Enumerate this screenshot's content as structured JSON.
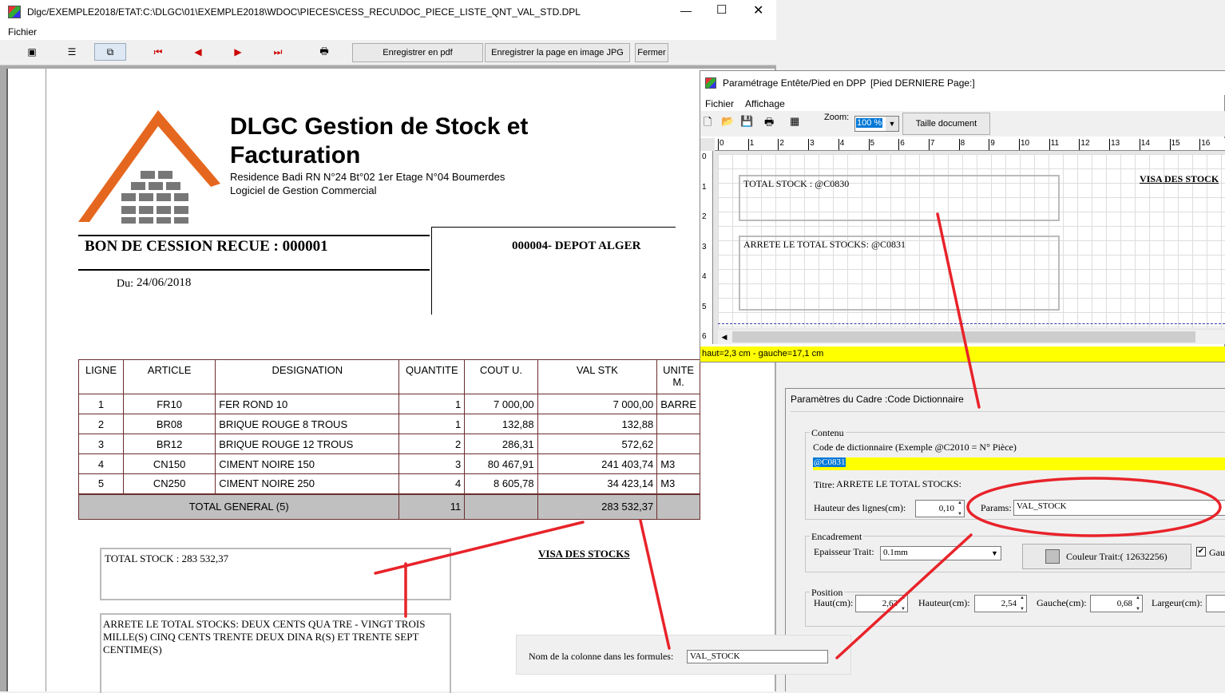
{
  "main_window": {
    "title": "Dlgc/EXEMPLE2018/ETAT:C:\\DLGC\\01\\EXEMPLE2018\\WDOC\\PIECES\\CESS_RECU\\DOC_PIECE_LISTE_QNT_VAL_STD.DPL",
    "menu": [
      "Fichier"
    ],
    "toolbar": {
      "save_pdf": "Enregistrer en pdf",
      "save_jpg": "Enregistrer la page en image JPG",
      "close": "Fermer"
    }
  },
  "document": {
    "company": "DLGC Gestion de Stock et Facturation",
    "address": "Residence Badi RN N°24 Bt°02 1er Etage N°04 Boumerdes",
    "subtitle": "Logiciel de Gestion Commercial",
    "doc_title": "BON DE CESSION RECUE : 000001",
    "depot": "000004- DEPOT ALGER",
    "date_label": "Du:",
    "date": "24/06/2018",
    "headers": [
      "LIGNE",
      "ARTICLE",
      "DESIGNATION",
      "QUANTITE",
      "COUT U.",
      "VAL STK",
      "UNITE M."
    ],
    "rows": [
      [
        "1",
        "FR10",
        "FER ROND 10",
        "1",
        "7 000,00",
        "7 000,00",
        "BARRE"
      ],
      [
        "2",
        "BR08",
        "BRIQUE ROUGE 8 TROUS",
        "1",
        "132,88",
        "132,88",
        ""
      ],
      [
        "3",
        "BR12",
        "BRIQUE ROUGE 12 TROUS",
        "2",
        "286,31",
        "572,62",
        ""
      ],
      [
        "4",
        "CN150",
        "CIMENT NOIRE 150",
        "3",
        "80 467,91",
        "241 403,74",
        "M3"
      ],
      [
        "5",
        "CN250",
        "CIMENT NOIRE 250",
        "4",
        "8 605,78",
        "34 423,14",
        "M3"
      ]
    ],
    "total_label": "TOTAL GENERAL  (5)",
    "total_qty": "11",
    "total_val": "283 532,37",
    "total_stock": "TOTAL STOCK : 283 532,37",
    "visa": "VISA  DES STOCKS",
    "arrete": "ARRETE LE TOTAL STOCKS: DEUX CENTS QUA TRE - VINGT TROIS MILLE(S) CINQ CENTS TRENTE DEUX DINA R(S) ET TRENTE SEPT CENTIME(S)"
  },
  "dpp_window": {
    "title": "Paramétrage Entête/Pied en DPP",
    "subtitle": "[Pied DERNIERE Page:]",
    "menu": [
      "Fichier",
      "Affichage"
    ],
    "zoom_label": "Zoom:",
    "zoom_value": "100 %",
    "page_size_btn": "Taille document",
    "ruler": [
      "0",
      "1",
      "2",
      "3",
      "4",
      "5",
      "6",
      "7",
      "8",
      "9",
      "10",
      "11",
      "12",
      "13",
      "14",
      "15",
      "16"
    ],
    "vruler": [
      "0",
      "1",
      "2",
      "3",
      "4",
      "5",
      "6"
    ],
    "box1": "TOTAL STOCK : @C0830",
    "box2": "ARRETE LE TOTAL STOCKS: @C0831",
    "visa": "VISA  DES STOCK",
    "status": "haut=2,3 cm - gauche=17,1 cm"
  },
  "params_window": {
    "title": "Paramètres du Cadre :Code Dictionnaire",
    "contenu_label": "Contenu",
    "code_label": "Code de dictionnaire (Exemple @C2010 = N° Pièce)",
    "code_value": "@C0831",
    "titre_label": "Titre:",
    "titre_value": "ARRETE LE TOTAL STOCKS:",
    "hauteur_lignes_label": "Hauteur des lignes(cm):",
    "hauteur_lignes_value": "0,10",
    "params_label": "Params:",
    "params_value": "VAL_STOCK",
    "encadrement_label": "Encadrement",
    "epaisseur_label": "Epaisseur Trait:",
    "epaisseur_value": "0.1mm",
    "couleur_btn": "Couleur Trait:( 12632256)",
    "gauche_check": "Gau",
    "position_label": "Position",
    "haut_label": "Haut(cm):",
    "haut_value": "2,63",
    "hauteur_label": "Hauteur(cm):",
    "hauteur_value": "2,54",
    "gauche_label": "Gauche(cm):",
    "gauche_value": "0,68",
    "largeur_label": "Largeur(cm):"
  },
  "column_popup": {
    "label": "Nom de la colonne dans les formules:",
    "value": "VAL_STOCK"
  },
  "colors": {
    "highlight_yellow": "#ffff00",
    "annotation_red": "#e8232a",
    "table_border": "#6b2d2d",
    "total_row": "#c0c0c0"
  }
}
